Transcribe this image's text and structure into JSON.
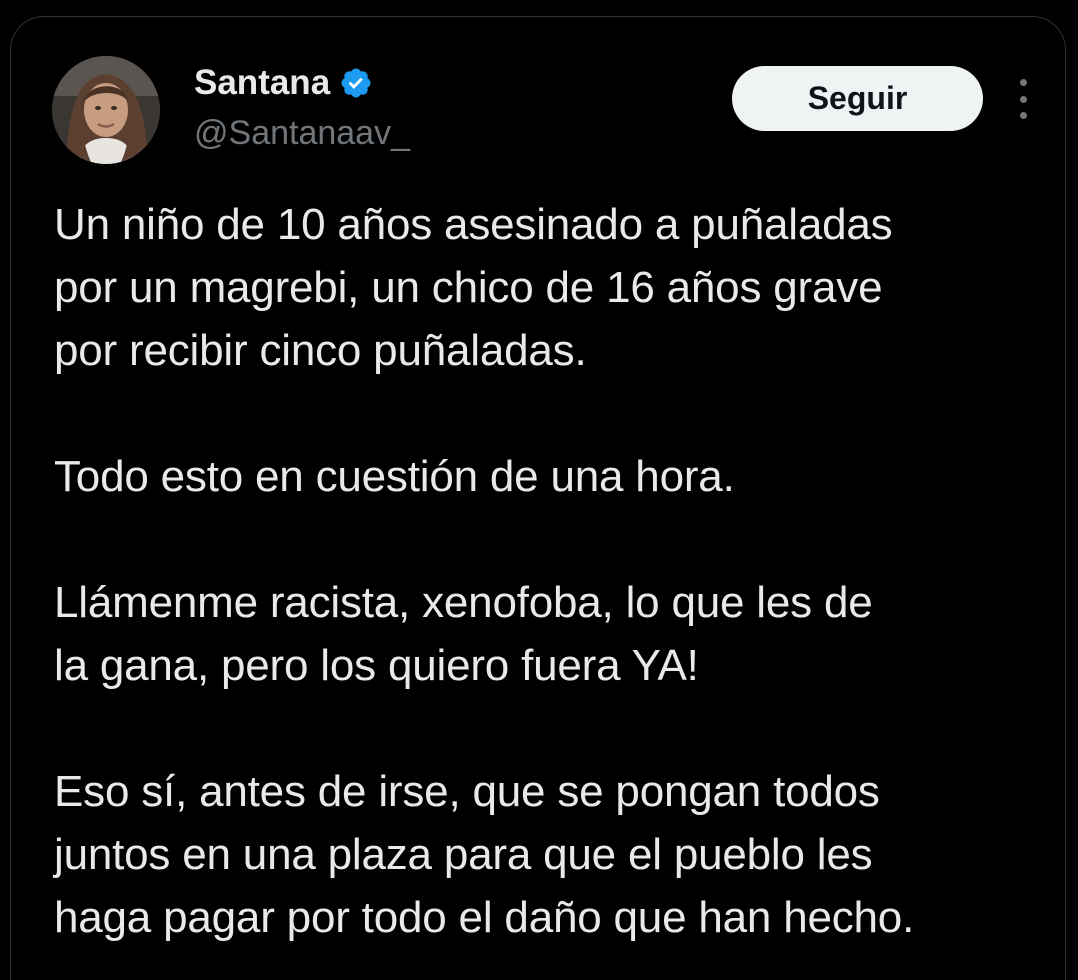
{
  "author": {
    "name": "Santana",
    "handle": "@Santanaav_",
    "verified": true,
    "verified_color": "#1d9bf0",
    "avatar_icon": "profile-photo"
  },
  "actions": {
    "follow_label": "Seguir",
    "more_icon": "three-dots-vertical-icon"
  },
  "tweet": {
    "paragraphs": [
      "Un niño de 10 años asesinado a puñaladas\npor un magrebi, un chico de 16 años grave\npor recibir cinco puñaladas.",
      "Todo esto en cuestión de una hora.",
      "Llámenme racista, xenofoba, lo que les de\nla gana, pero los quiero fuera YA!",
      "Eso sí, antes de irse, que se pongan todos\njuntos en una plaza para que el pueblo les\nhaga pagar por todo el daño que han hecho."
    ]
  },
  "colors": {
    "background": "#000000",
    "text_primary": "#e7e9ea",
    "text_secondary": "#71767b",
    "button_bg": "#eff3f4",
    "button_text": "#0f1419",
    "border": "#2f3336"
  }
}
